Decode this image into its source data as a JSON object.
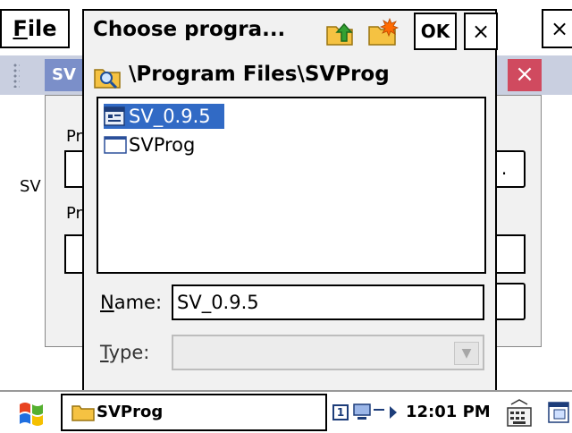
{
  "background_app": {
    "menu_file": "File",
    "menu_file_underline": "F",
    "menu_file_rest": "ile",
    "close_glyph": "×",
    "title_fragment": "SV",
    "dialog_close_glyph": "×",
    "label_1": "Pr",
    "label_2": "SV",
    "label_3": "Pr",
    "button_fragment_1": ".",
    "button_fragment_2": ""
  },
  "picker": {
    "title": "Choose progra...",
    "ok_label": "OK",
    "close_glyph": "×",
    "path": "\\Program Files\\SVProg",
    "items": [
      {
        "label": "SV_0.9.5",
        "icon": "program-icon",
        "selected": true
      },
      {
        "label": "SVProg",
        "icon": "window-icon",
        "selected": false
      }
    ],
    "name_label": "Name:",
    "name_label_underline": "N",
    "name_label_rest": "ame:",
    "name_value": "SV_0.9.5",
    "type_label": "Type:",
    "type_label_underline": "T",
    "type_label_rest": "ype:",
    "type_value": ""
  },
  "taskbar": {
    "task_label": "SVProg",
    "tray_badge": "1",
    "clock": "12:01 PM"
  },
  "colors": {
    "selection": "#316ac5",
    "title_bar_blue": "#7b8fc9",
    "close_red": "#d04a5f",
    "toolbar_bg": "#c9cfe0"
  }
}
